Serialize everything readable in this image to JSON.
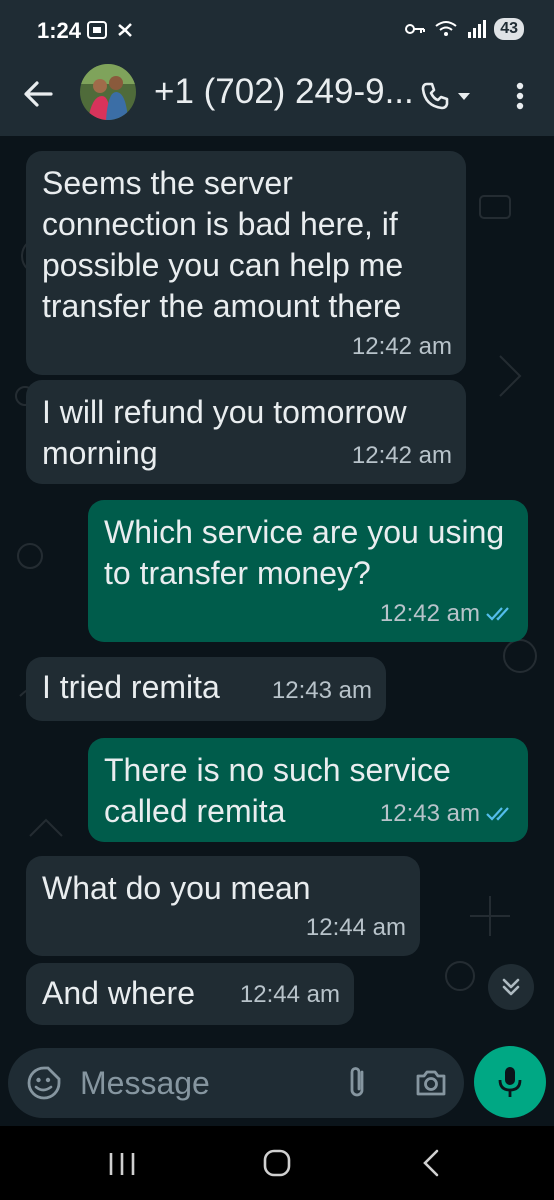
{
  "status_bar": {
    "time": "1:24",
    "battery": "43"
  },
  "header": {
    "contact_name": "+1 (702) 249-9..."
  },
  "messages": [
    {
      "direction": "incoming",
      "text": "Seems the server connection is bad here, if possible you can help me transfer the amount there",
      "time": "12:42 am"
    },
    {
      "direction": "incoming",
      "text": "I will refund you tomorrow morning",
      "time": "12:42 am"
    },
    {
      "direction": "outgoing",
      "text": "Which service are you using to transfer money?",
      "time": "12:42 am",
      "status": "read"
    },
    {
      "direction": "incoming",
      "text": "I tried remita",
      "time": "12:43 am"
    },
    {
      "direction": "outgoing",
      "text": "There is no such service called remita",
      "time": "12:43 am",
      "status": "read"
    },
    {
      "direction": "incoming",
      "text": "What do you mean",
      "time": "12:44 am"
    },
    {
      "direction": "incoming",
      "text": "And where",
      "time": "12:44 am"
    }
  ],
  "composer": {
    "placeholder": "Message"
  },
  "icons": {
    "back": "arrow-left-icon",
    "call": "phone-icon",
    "more": "more-vert-icon",
    "emoji": "emoji-icon",
    "attach": "paperclip-icon",
    "camera": "camera-icon",
    "mic": "mic-icon",
    "scroll": "double-chevron-down-icon"
  },
  "colors": {
    "incoming_bubble": "#202c33",
    "outgoing_bubble": "#005c4b",
    "accent": "#00a884",
    "read_ticks": "#53bdeb"
  }
}
